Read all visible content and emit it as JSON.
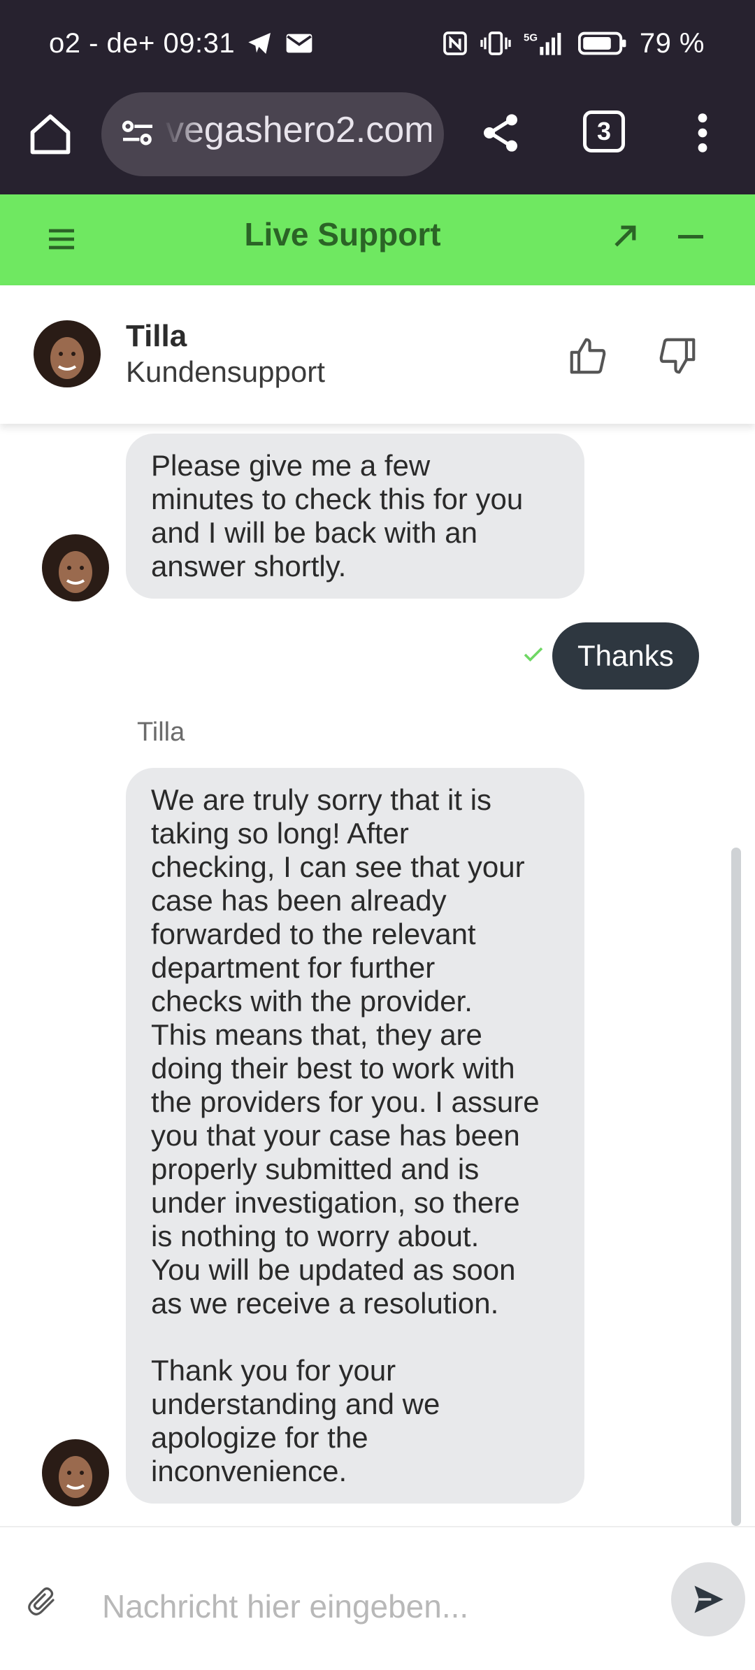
{
  "status_bar": {
    "carrier_time": "o2 - de+ 09:31",
    "battery": "79 %"
  },
  "browser": {
    "url": "vegashero2.com",
    "tab_count": "3"
  },
  "support": {
    "title": "Live Support"
  },
  "agent": {
    "name": "Tilla",
    "role": "Kundensupport"
  },
  "messages": [
    {
      "from": "agent",
      "text": "Please give me a few\nminutes to check this for you\nand I will be back with an\nanswer shortly."
    },
    {
      "from": "user",
      "text": "Thanks",
      "status": "sent"
    },
    {
      "from": "agent",
      "sender_label": "Tilla",
      "text": "We are truly sorry that it is\ntaking so long! After\nchecking, I can see that your\ncase has been already\nforwarded to the relevant\ndepartment for further\nchecks with the provider.\nThis means that, they are\ndoing their best to work with\nthe providers for you. I assure\nyou that your case has been\nproperly submitted and is\nunder investigation, so there\nis nothing to worry about.\nYou will be updated as soon\nas we receive a resolution.\n\nThank you for your\nunderstanding and we\napologize for the\ninconvenience."
    }
  ],
  "composer": {
    "placeholder": "Nachricht hier eingeben..."
  },
  "colors": {
    "status_bg": "#27222f",
    "header_green": "#6fe861",
    "header_text": "#2b6426",
    "agent_bubble": "#e8e9eb",
    "user_bubble": "#2e3740"
  }
}
